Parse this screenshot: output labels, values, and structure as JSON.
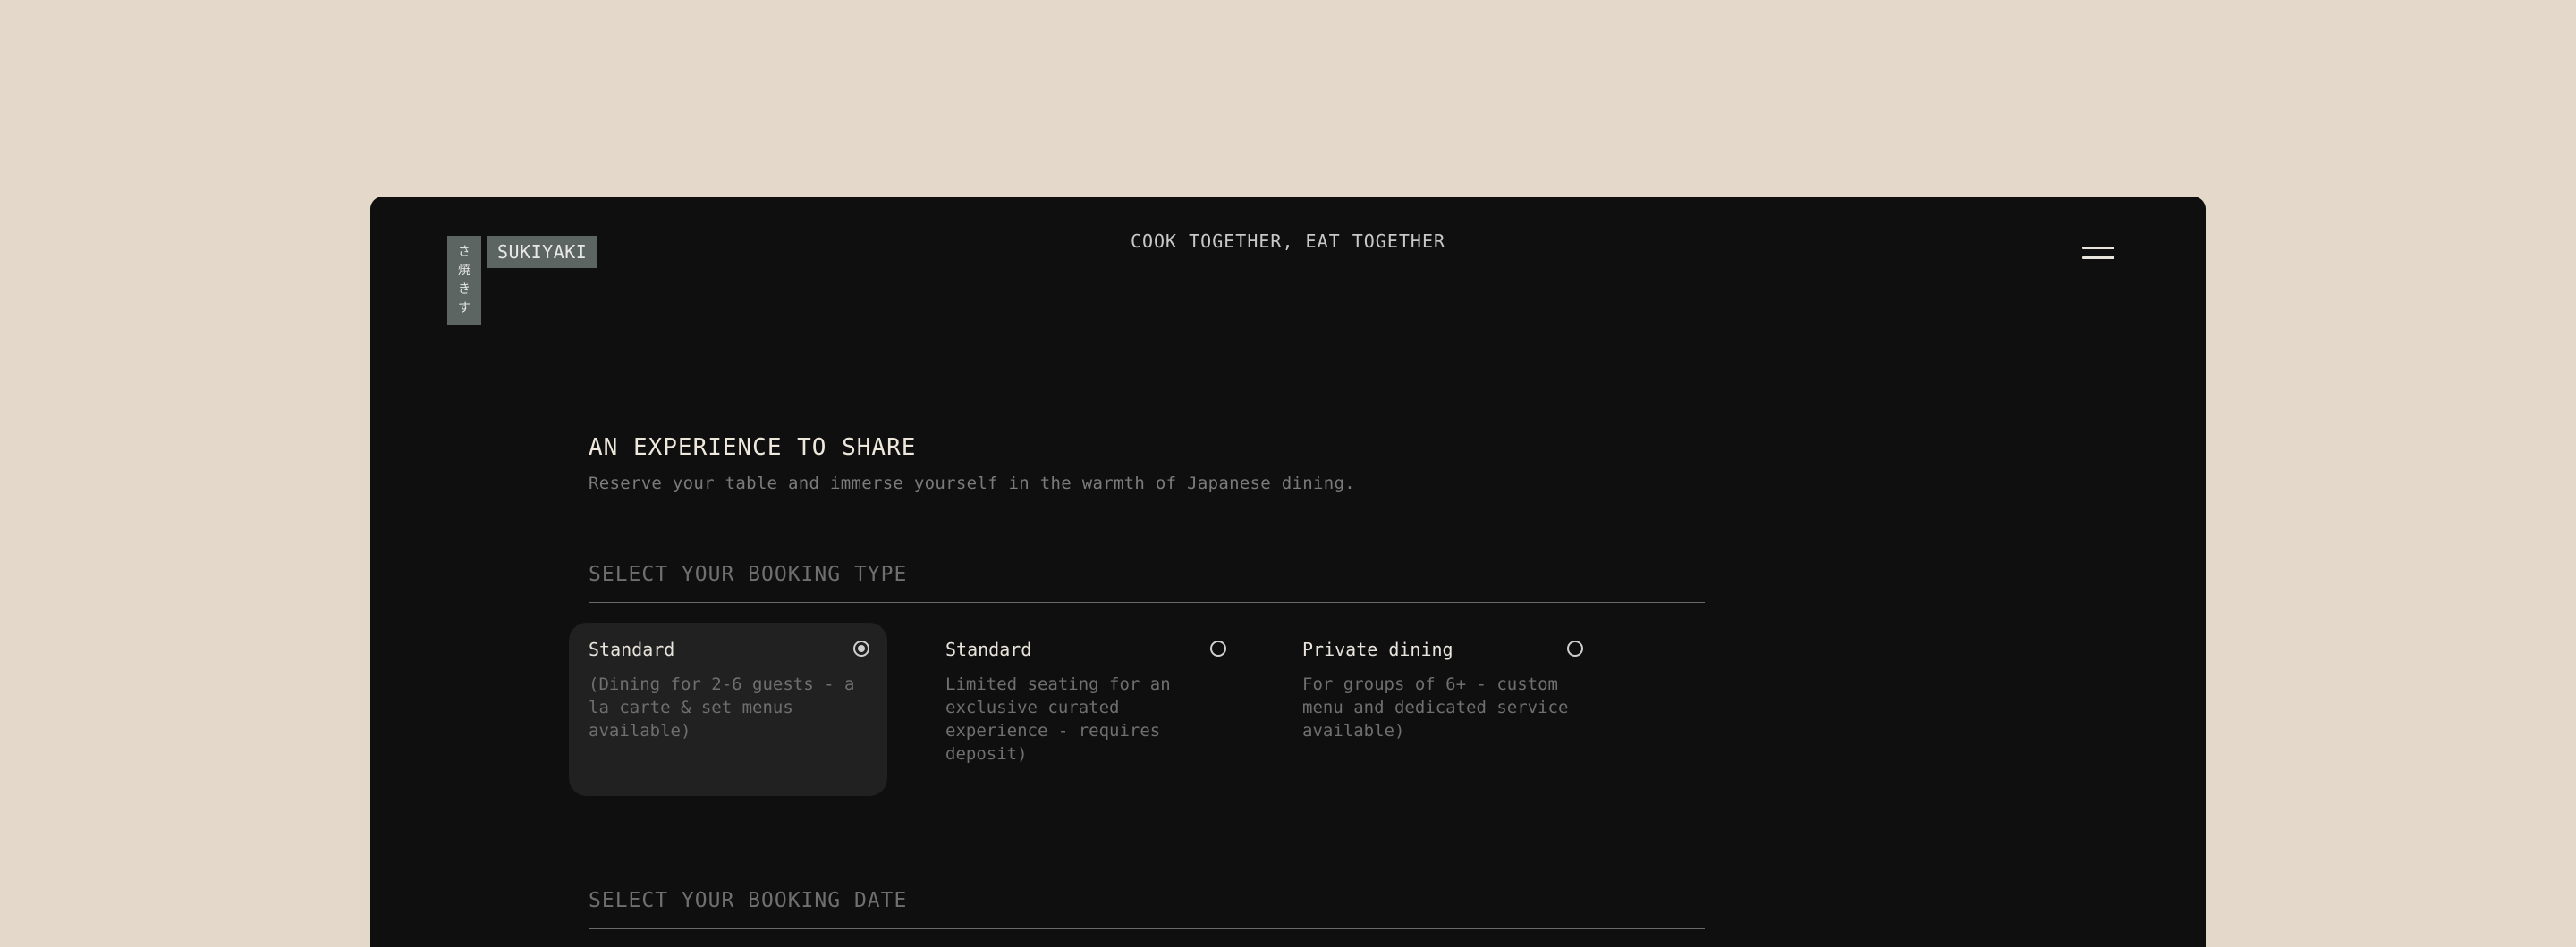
{
  "header": {
    "logo_vertical": [
      "さ",
      "焼",
      "き",
      "す"
    ],
    "logo_word": "SUKIYAKI",
    "tagline": "COOK TOGETHER, EAT TOGETHER",
    "menu_icon": "hamburger-menu-icon"
  },
  "intro": {
    "title": "AN EXPERIENCE TO SHARE",
    "subtitle": "Reserve your table and immerse yourself in the warmth of Japanese dining."
  },
  "booking_type": {
    "label": "SELECT YOUR BOOKING TYPE",
    "options": [
      {
        "title": "Standard",
        "description": "(Dining for 2-6 guests - a la carte & set menus available)",
        "selected": true
      },
      {
        "title": "Standard",
        "description": "Limited seating for an exclusive curated experience - requires deposit)",
        "selected": false
      },
      {
        "title": "Private dining",
        "description": "For groups of 6+ - custom menu and dedicated service available)",
        "selected": false
      }
    ]
  },
  "booking_date": {
    "label": "SELECT YOUR BOOKING DATE"
  },
  "colors": {
    "page_background": "#e3d8ca",
    "panel_background": "#0f0f0f",
    "logo_background": "#5d6563",
    "selected_card": "#212121"
  }
}
